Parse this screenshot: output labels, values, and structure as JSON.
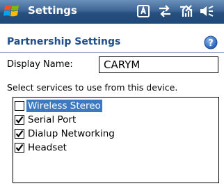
{
  "titlebar": {
    "app_title": "Settings",
    "start_icon": "windows-flag-icon",
    "status_icons": [
      "keyboard-lock-icon",
      "connectivity-arrows-icon",
      "no-signal-icon",
      "speaker-muted-icon"
    ]
  },
  "header": {
    "title": "Partnership Settings",
    "help_icon": "help-icon"
  },
  "form": {
    "display_name_label": "Display Name:",
    "display_name_value": "CARYM",
    "instruction": "Select services to use from this device."
  },
  "services": [
    {
      "label": "Wireless Stereo",
      "checked": false,
      "selected": true
    },
    {
      "label": "Serial Port",
      "checked": true,
      "selected": false
    },
    {
      "label": "Dialup Networking",
      "checked": true,
      "selected": false
    },
    {
      "label": "Headset",
      "checked": true,
      "selected": false
    }
  ],
  "colors": {
    "titlebar_blue": "#27507f",
    "header_text": "#1f4e8a",
    "selection": "#3d79c0"
  }
}
